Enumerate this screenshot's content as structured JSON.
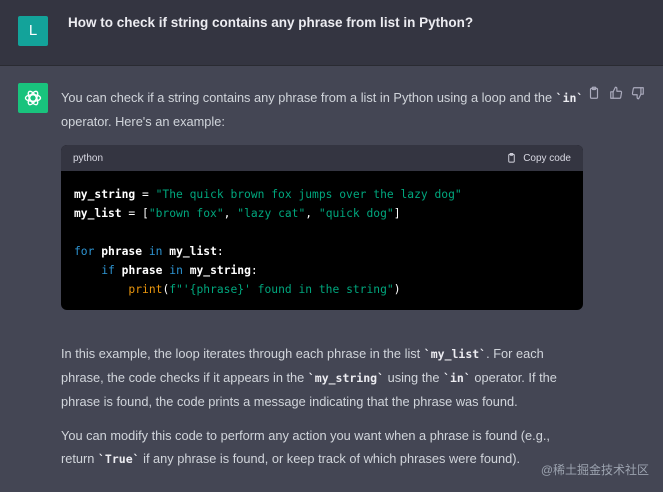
{
  "user_message": {
    "avatar_letter": "L",
    "text": "How to check if string contains any phrase from list in Python?"
  },
  "assistant_message": {
    "para1_before": "You can check if a string contains any phrase from a list in Python using a loop and the ",
    "para1_code": "`in`",
    "para1_after": " operator. Here's an example:",
    "code_block": {
      "language": "python",
      "copy_label": "Copy code",
      "lines": [
        "my_string = \"The quick brown fox jumps over the lazy dog\"",
        "my_list = [\"brown fox\", \"lazy cat\", \"quick dog\"]",
        "",
        "for phrase in my_list:",
        "    if phrase in my_string:",
        "        print(f\"'{phrase}' found in the string\")"
      ]
    },
    "para2_a": "In this example, the loop iterates through each phrase in the list ",
    "para2_code1": "`my_list`",
    "para2_b": ". For each phrase, the code checks if it appears in the ",
    "para2_code2": "`my_string`",
    "para2_c": " using the ",
    "para2_code3": "`in`",
    "para2_d": " operator. If the phrase is found, the code prints a message indicating that the phrase was found.",
    "para3_a": "You can modify this code to perform any action you want when a phrase is found (e.g., return ",
    "para3_code": "`True`",
    "para3_b": " if any phrase is found, or keep track of which phrases were found)."
  },
  "watermark": "@稀土掘金技术社区",
  "icons": [
    "clipboard-icon",
    "thumbs-up-icon",
    "thumbs-down-icon",
    "openai-logo-icon"
  ],
  "colors": {
    "user_bg": "#343541",
    "assistant_bg": "#444654",
    "user_avatar": "#13a39a",
    "gpt_avatar": "#19c37d"
  }
}
